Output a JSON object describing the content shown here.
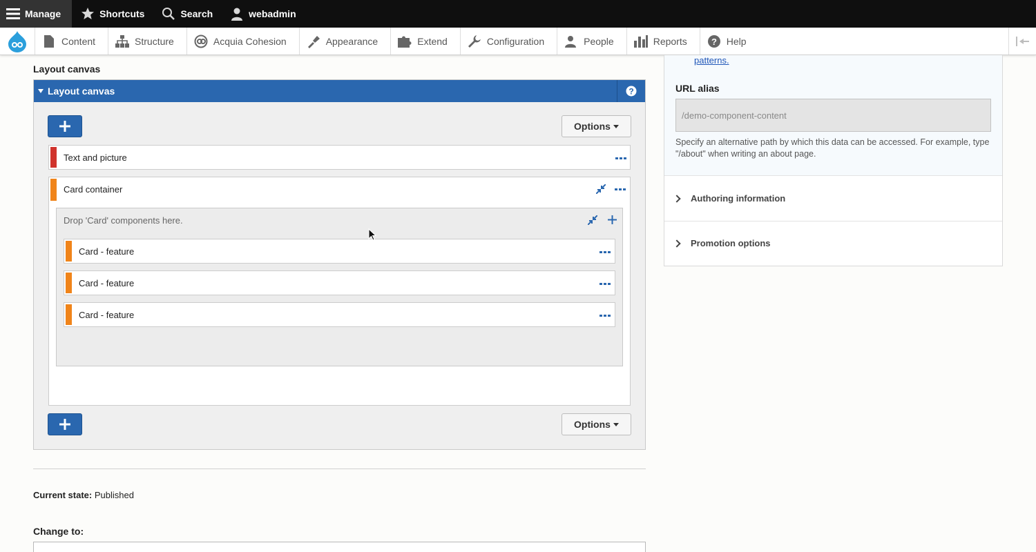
{
  "toolbar": {
    "manage": "Manage",
    "shortcuts": "Shortcuts",
    "search": "Search",
    "user": "webadmin"
  },
  "tray": {
    "items": [
      "Content",
      "Structure",
      "Acquia Cohesion",
      "Appearance",
      "Extend",
      "Configuration",
      "People",
      "Reports",
      "Help"
    ]
  },
  "main": {
    "section_title": "Layout canvas",
    "canvas_title": "Layout canvas",
    "options_label": "Options",
    "components": {
      "text_picture": "Text and picture",
      "card_container": "Card container",
      "dropzone_hint": "Drop 'Card' components here.",
      "cards": [
        "Card - feature",
        "Card - feature",
        "Card - feature"
      ]
    },
    "current_state_label": "Current state:",
    "current_state_value": "Published",
    "change_to_label": "Change to:"
  },
  "sidebar": {
    "patterns_link": "patterns.",
    "url_alias_label": "URL alias",
    "url_alias_value": "/demo-component-content",
    "url_alias_desc": "Specify an alternative path by which this data can be accessed. For example, type \"/about\" when writing an about page.",
    "authoring": "Authoring information",
    "promotion": "Promotion options"
  },
  "colors": {
    "toolbar_bg": "#0f0f0f",
    "accent_blue": "#2a67af",
    "red_bar": "#d0332c",
    "orange_bar": "#f0841a"
  }
}
